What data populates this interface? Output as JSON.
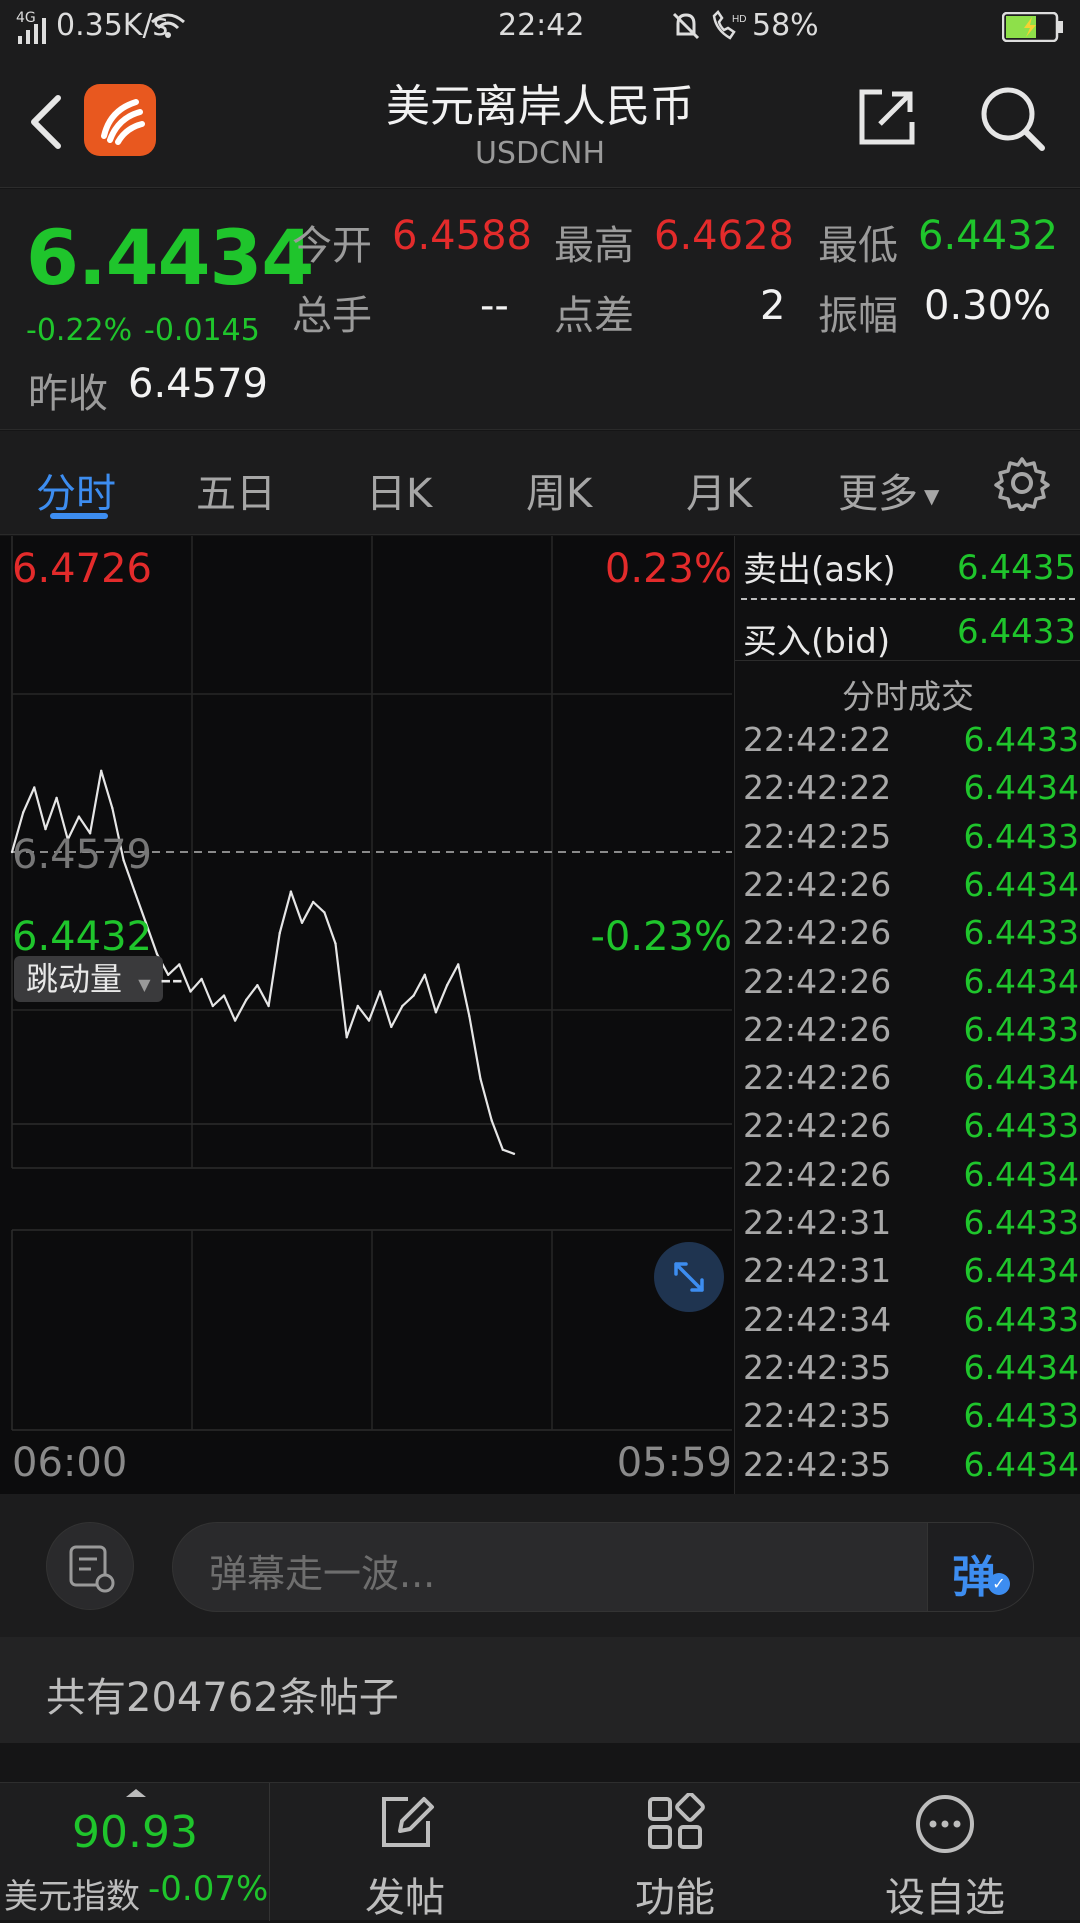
{
  "status": {
    "network": "4G",
    "speed": "0.35K/s",
    "time": "22:42",
    "battery": "58%"
  },
  "nav": {
    "title": "美元离岸人民币",
    "subtitle": "USDCNH",
    "back_icon": "chevron-left-icon",
    "share_icon": "share-icon",
    "search_icon": "search-icon"
  },
  "quote": {
    "price": "6.4434",
    "change_pct": "-0.22%",
    "change": "-0.0145",
    "prev_close_label": "昨收",
    "prev_close": "6.4579",
    "open_label": "今开",
    "open": "6.4588",
    "high_label": "最高",
    "high": "6.4628",
    "low_label": "最低",
    "low": "6.4432",
    "volume_label": "总手",
    "volume": "--",
    "spread_label": "点差",
    "spread": "2",
    "amplitude_label": "振幅",
    "amplitude": "0.30%"
  },
  "tabs": [
    "分时",
    "五日",
    "日K",
    "周K",
    "月K",
    "更多"
  ],
  "chart_data": {
    "type": "line",
    "y_top_label": "6.4726",
    "y_top_pct": "0.23%",
    "y_bottom_label": "6.4432",
    "y_bottom_pct": "-0.23%",
    "ref_label": "6.4579",
    "ylim": [
      6.4432,
      6.4726
    ],
    "x_start": "06:00",
    "x_end": "05:59",
    "values": [
      6.4579,
      6.4598,
      6.461,
      6.459,
      6.4605,
      6.4585,
      6.4596,
      6.4588,
      6.4618,
      6.46,
      6.4575,
      6.456,
      6.4545,
      6.453,
      6.452,
      6.4525,
      6.4512,
      6.4518,
      6.4505,
      6.451,
      6.4498,
      6.4508,
      6.4515,
      6.4505,
      6.454,
      6.456,
      6.4545,
      6.4555,
      6.455,
      6.4535,
      6.449,
      6.4505,
      6.4498,
      6.4512,
      6.4495,
      6.4505,
      6.451,
      6.452,
      6.4502,
      6.4515,
      6.4525,
      6.45,
      6.447,
      6.445,
      6.4436,
      6.4434
    ]
  },
  "volume_selector": {
    "label": "跳动量",
    "value": "--",
    "expand_icon": "expand-icon"
  },
  "depth": {
    "ask_label": "卖出(ask)",
    "ask": "6.4435",
    "bid_label": "买入(bid)",
    "bid": "6.4433",
    "ticks_title": "分时成交",
    "ticks": [
      {
        "t": "22:42:22",
        "p": "6.4433"
      },
      {
        "t": "22:42:22",
        "p": "6.4434"
      },
      {
        "t": "22:42:25",
        "p": "6.4433"
      },
      {
        "t": "22:42:26",
        "p": "6.4434"
      },
      {
        "t": "22:42:26",
        "p": "6.4433"
      },
      {
        "t": "22:42:26",
        "p": "6.4434"
      },
      {
        "t": "22:42:26",
        "p": "6.4433"
      },
      {
        "t": "22:42:26",
        "p": "6.4434"
      },
      {
        "t": "22:42:26",
        "p": "6.4433"
      },
      {
        "t": "22:42:26",
        "p": "6.4434"
      },
      {
        "t": "22:42:31",
        "p": "6.4433"
      },
      {
        "t": "22:42:31",
        "p": "6.4434"
      },
      {
        "t": "22:42:34",
        "p": "6.4433"
      },
      {
        "t": "22:42:35",
        "p": "6.4434"
      },
      {
        "t": "22:42:35",
        "p": "6.4433"
      },
      {
        "t": "22:42:35",
        "p": "6.4434"
      }
    ]
  },
  "danmu": {
    "placeholder": "弹幕走一波...",
    "send_label": "弹"
  },
  "posts": {
    "count_text": "共有204762条帖子"
  },
  "footer": {
    "index_value": "90.93",
    "index_label": "美元指数",
    "index_change": "-0.07%",
    "post_label": "发帖",
    "func_label": "功能",
    "watch_label": "设自选"
  },
  "colors": {
    "up": "#e32b2b",
    "down": "#1fc52c",
    "accent": "#3d8df0"
  }
}
